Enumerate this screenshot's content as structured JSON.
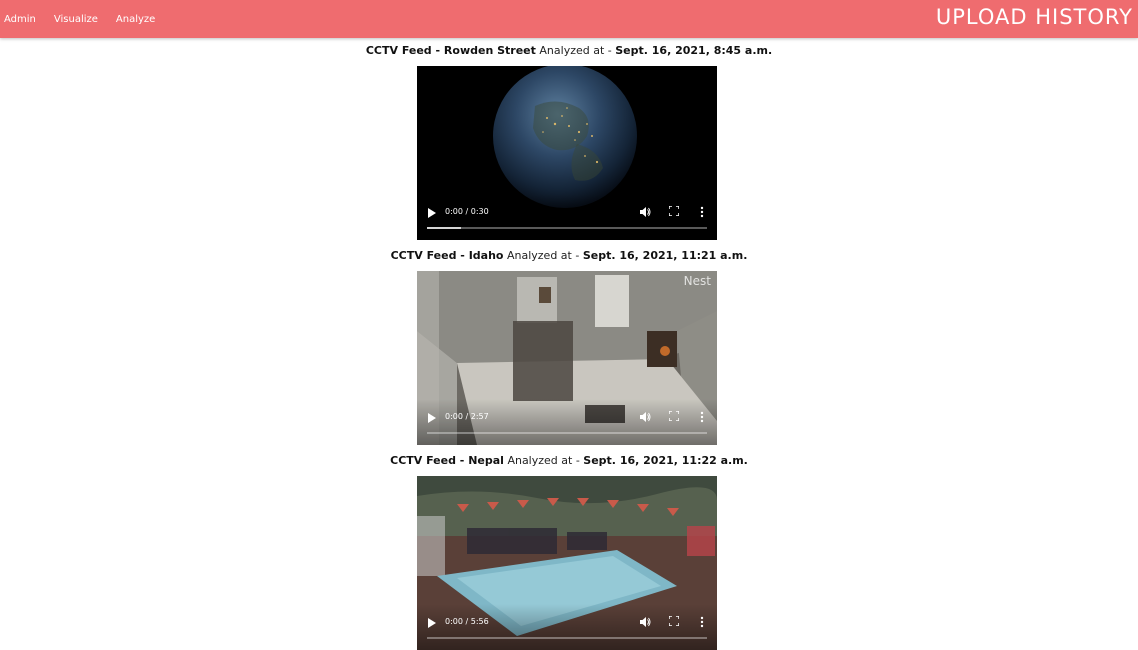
{
  "nav": {
    "links": [
      "Admin",
      "Visualize",
      "Analyze"
    ],
    "brand": "UPLOAD HISTORY"
  },
  "colors": {
    "navbar": "#ef6c6f",
    "text": "#222222"
  },
  "feeds": [
    {
      "prefix": "CCTV Feed - ",
      "location": "Rowden Street",
      "analyzed_text": " Analyzed at - ",
      "timestamp": "Sept. 16, 2021, 8:45 a.m.",
      "time_display": "0:00 / 0:30",
      "buffered": 0.12,
      "thumbnail": "earth-at-night"
    },
    {
      "prefix": "CCTV Feed - ",
      "location": "Idaho",
      "analyzed_text": " Analyzed at - ",
      "timestamp": "Sept. 16, 2021, 11:21 a.m.",
      "time_display": "0:00 / 2:57",
      "buffered": 0.0,
      "watermark": "Nest",
      "thumbnail": "living-room-camera"
    },
    {
      "prefix": "CCTV Feed - ",
      "location": "Nepal",
      "analyzed_text": " Analyzed at - ",
      "timestamp": "Sept. 16, 2021, 11:22 a.m.",
      "time_display": "0:00 / 5:56",
      "buffered": 0.0,
      "thumbnail": "pool-party-yard"
    }
  ],
  "icons": [
    "play-icon",
    "volume-icon",
    "fullscreen-icon",
    "more-options-icon"
  ]
}
